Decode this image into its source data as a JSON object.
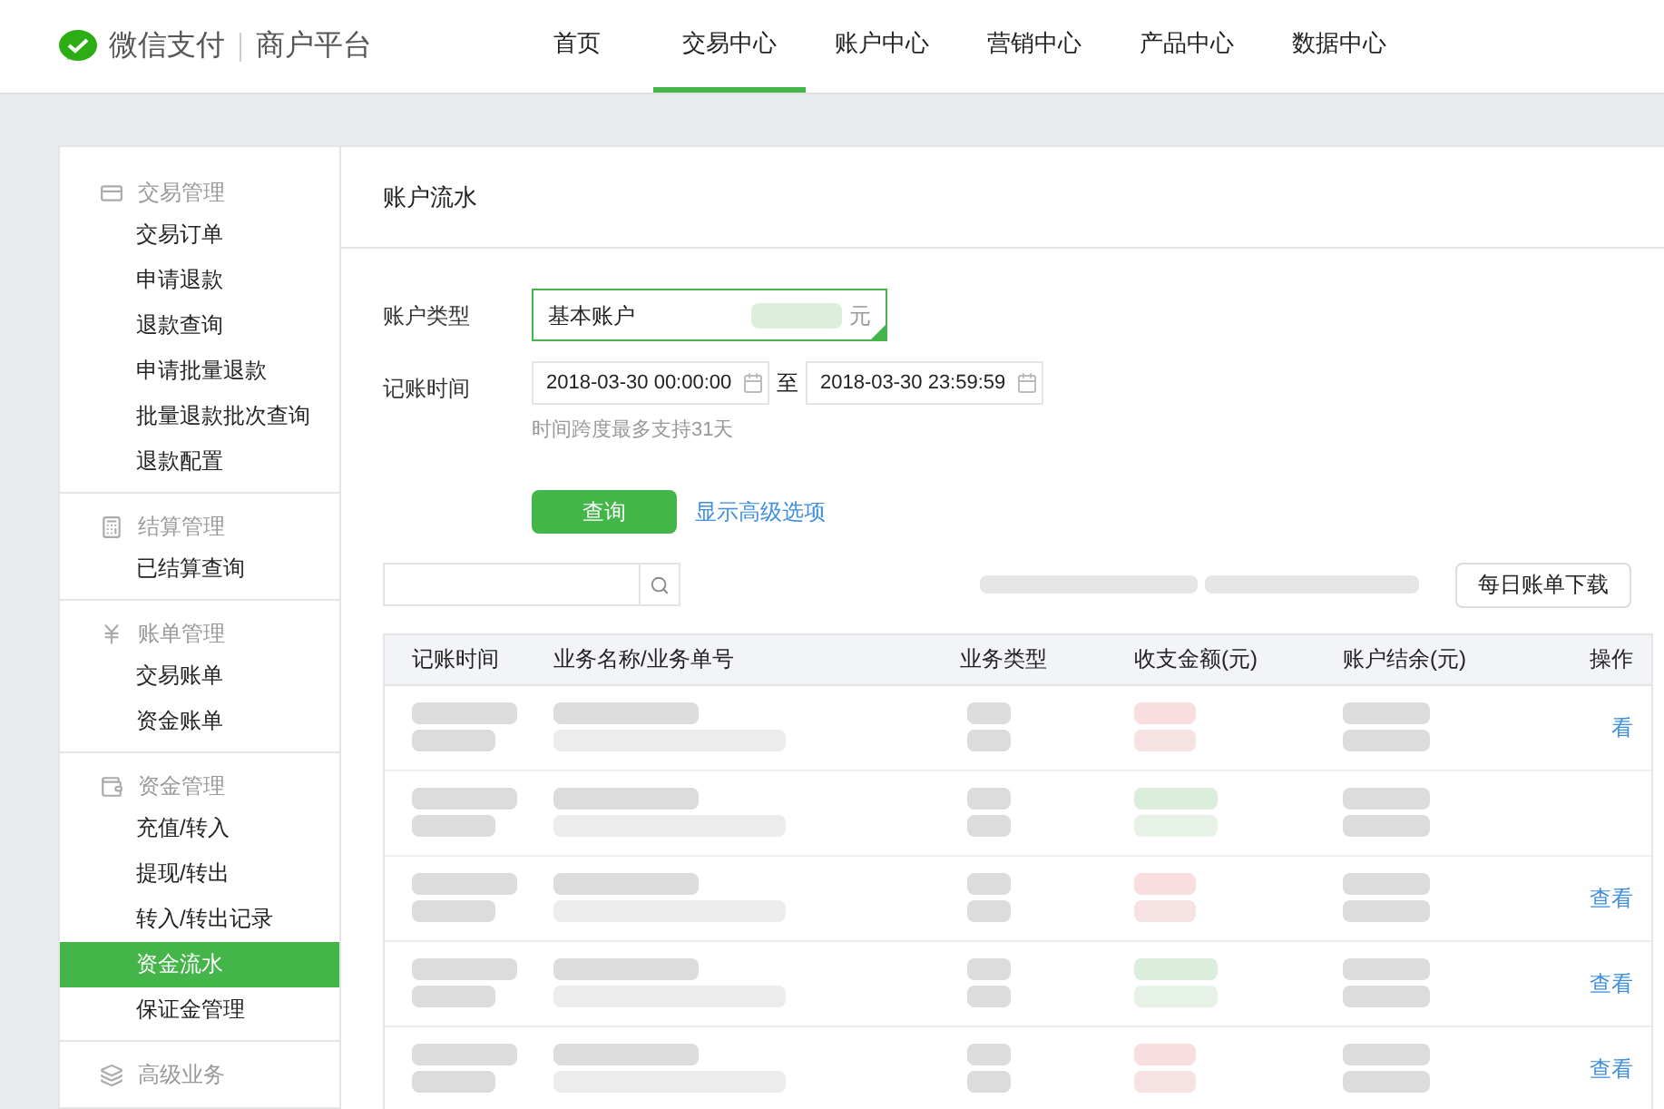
{
  "brand": {
    "name": "微信支付",
    "subtitle": "商户平台"
  },
  "nav": [
    {
      "label": "首页",
      "selected": false
    },
    {
      "label": "交易中心",
      "selected": true
    },
    {
      "label": "账户中心",
      "selected": false
    },
    {
      "label": "营销中心",
      "selected": false
    },
    {
      "label": "产品中心",
      "selected": false
    },
    {
      "label": "数据中心",
      "selected": false
    }
  ],
  "sidebar": [
    {
      "title": "交易管理",
      "items": [
        {
          "label": "交易订单",
          "selected": false
        },
        {
          "label": "申请退款",
          "selected": false
        },
        {
          "label": "退款查询",
          "selected": false
        },
        {
          "label": "申请批量退款",
          "selected": false
        },
        {
          "label": "批量退款批次查询",
          "selected": false
        },
        {
          "label": "退款配置",
          "selected": false
        }
      ]
    },
    {
      "title": "结算管理",
      "items": [
        {
          "label": "已结算查询",
          "selected": false
        }
      ]
    },
    {
      "title": "账单管理",
      "items": [
        {
          "label": "交易账单",
          "selected": false
        },
        {
          "label": "资金账单",
          "selected": false
        }
      ]
    },
    {
      "title": "资金管理",
      "items": [
        {
          "label": "充值/转入",
          "selected": false
        },
        {
          "label": "提现/转出",
          "selected": false
        },
        {
          "label": "转入/转出记录",
          "selected": false
        },
        {
          "label": "资金流水",
          "selected": true
        },
        {
          "label": "保证金管理",
          "selected": false
        }
      ]
    },
    {
      "title": "高级业务"
    }
  ],
  "page_title": "账户流水",
  "form": {
    "account_label": "账户类型",
    "account_value": "基本账户",
    "account_unit": "元",
    "time_label": "记账时间",
    "start": "2018-03-30 00:00:00",
    "to": "至",
    "end": "2018-03-30 23:59:59",
    "hint": "时间跨度最多支持31天",
    "query_button": "查询",
    "advanced_link": "显示高级选项"
  },
  "download_button": "每日账单下载",
  "table": {
    "columns": [
      "记账时间",
      "业务名称/业务单号",
      "业务类型",
      "收支金额(元)",
      "账户结余(元)",
      "操作"
    ],
    "rows": [
      {
        "kind": "expense",
        "action": "看"
      },
      {
        "kind": "income"
      },
      {
        "kind": "expense",
        "action": "查看"
      },
      {
        "kind": "income",
        "action": "查看"
      },
      {
        "kind": "expense",
        "action": "查看"
      }
    ]
  }
}
